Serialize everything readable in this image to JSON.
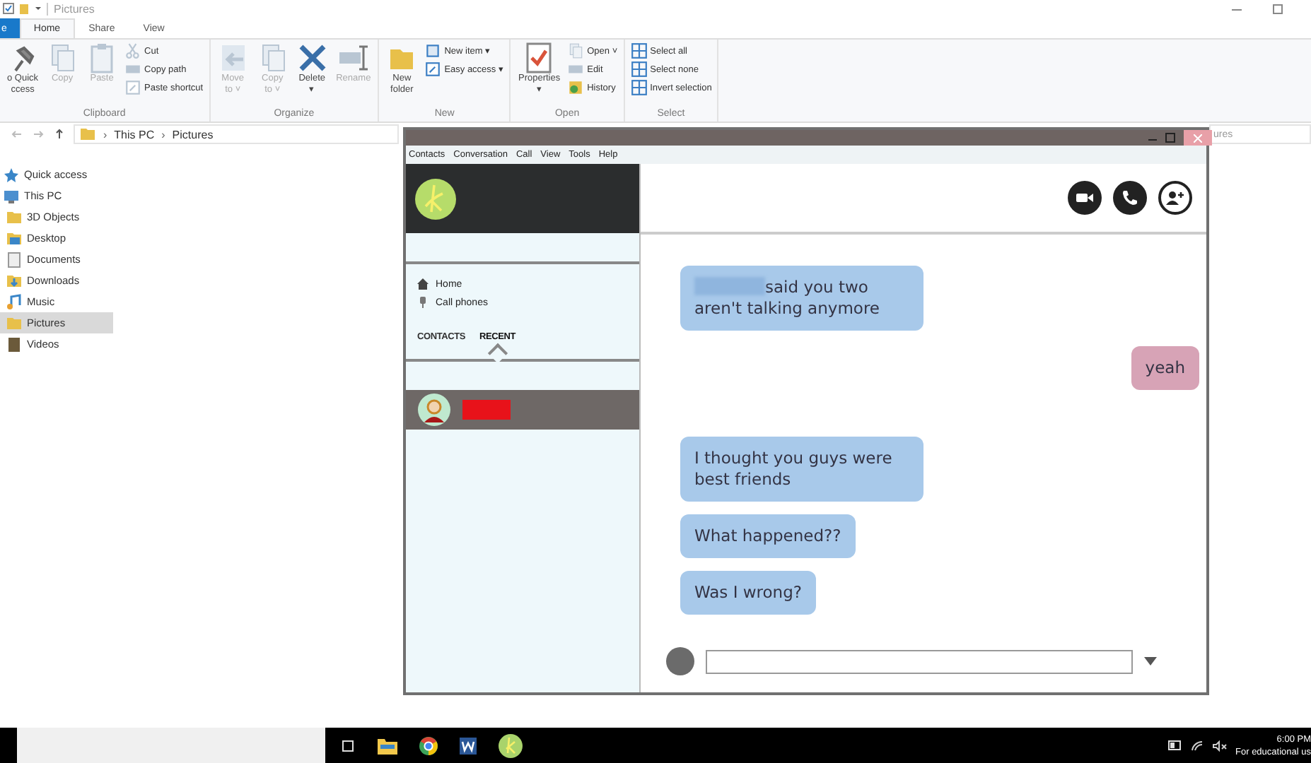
{
  "explorer": {
    "title": "Pictures",
    "ribbon_tabs": [
      {
        "label": "e",
        "kind": "file",
        "selected": false
      },
      {
        "label": "Home",
        "kind": "tab",
        "selected": true
      },
      {
        "label": "Share",
        "kind": "tab",
        "selected": false
      },
      {
        "label": "View",
        "kind": "tab",
        "selected": false
      }
    ],
    "ribbon_groups": [
      {
        "name": "Clipboard",
        "large": [
          {
            "lines": [
              "o Quick",
              "ccess"
            ],
            "kind": "pin",
            "disabled": false
          },
          {
            "lines": [
              "Copy"
            ],
            "kind": "pages",
            "disabled": true
          },
          {
            "lines": [
              "Paste"
            ],
            "kind": "clipboard",
            "disabled": true
          }
        ],
        "small": [
          {
            "label": "Cut",
            "kind": "scissors",
            "disabled": true
          },
          {
            "label": "Copy path",
            "kind": "path",
            "disabled": true
          },
          {
            "label": "Paste shortcut",
            "kind": "shortcut",
            "disabled": true
          }
        ]
      },
      {
        "name": "Organize",
        "large": [
          {
            "lines": [
              "Move",
              "to ˅"
            ],
            "kind": "move",
            "disabled": true
          },
          {
            "lines": [
              "Copy",
              "to ˅"
            ],
            "kind": "pages",
            "disabled": true
          },
          {
            "lines": [
              "Delete",
              "▾"
            ],
            "kind": "cross",
            "disabled": false
          },
          {
            "lines": [
              "Rename"
            ],
            "kind": "rename",
            "disabled": true
          }
        ]
      },
      {
        "name": "New",
        "large": [
          {
            "lines": [
              "New",
              "folder"
            ],
            "kind": "folder",
            "disabled": false
          }
        ],
        "small": [
          {
            "label": "New item ▾",
            "kind": "newitem",
            "disabled": false
          },
          {
            "label": "Easy access ▾",
            "kind": "shortcut",
            "disabled": false
          }
        ]
      },
      {
        "name": "Open",
        "large": [
          {
            "lines": [
              "Properties",
              "▾"
            ],
            "kind": "check",
            "disabled": false
          }
        ],
        "small": [
          {
            "label": "Open ˅",
            "kind": "pages",
            "disabled": true
          },
          {
            "label": "Edit",
            "kind": "path",
            "disabled": true
          },
          {
            "label": "History",
            "kind": "history",
            "disabled": false
          }
        ]
      },
      {
        "name": "Select",
        "small": [
          {
            "label": "Select all",
            "kind": "grid",
            "disabled": false
          },
          {
            "label": "Select none",
            "kind": "grid",
            "disabled": false
          },
          {
            "label": "Invert selection",
            "kind": "grid",
            "disabled": false
          }
        ]
      }
    ],
    "breadcrumb": [
      {
        "separator": "›",
        "label": "This PC"
      },
      {
        "separator": "›",
        "label": "Pictures"
      }
    ],
    "search_text": "ures",
    "nav_items": [
      {
        "label": "Quick access",
        "kind": "star",
        "selected": false
      },
      {
        "label": "This PC",
        "kind": "pc",
        "selected": false
      },
      {
        "label": "3D Objects",
        "kind": "folder",
        "selected": false
      },
      {
        "label": "Desktop",
        "kind": "desktop",
        "selected": false
      },
      {
        "label": "Documents",
        "kind": "doc",
        "selected": false
      },
      {
        "label": "Downloads",
        "kind": "download",
        "selected": false
      },
      {
        "label": "Music",
        "kind": "music",
        "selected": false
      },
      {
        "label": "Pictures",
        "kind": "folder",
        "selected": true
      },
      {
        "label": "Videos",
        "kind": "video",
        "selected": false
      }
    ]
  },
  "chat": {
    "menu": [
      "Contacts",
      "Conversation",
      "Call",
      "View",
      "Tools",
      "Help"
    ],
    "nav": [
      {
        "label": "Home",
        "kind": "home"
      },
      {
        "label": "Call phones",
        "kind": "phone"
      }
    ],
    "tabs": [
      {
        "label": "CONTACTS",
        "selected": false
      },
      {
        "label": "RECENT",
        "selected": true
      }
    ],
    "recent": [
      {
        "name_redacted": true,
        "selected": true
      }
    ],
    "messages": [
      {
        "kind": "incoming",
        "redacted_prefix": true,
        "text": "said you two aren't talking anymore"
      },
      {
        "kind": "outgoing",
        "redacted_prefix": false,
        "text": "yeah"
      },
      {
        "kind": "incoming",
        "redacted_prefix": false,
        "text": "I thought you guys were best friends"
      },
      {
        "kind": "incoming",
        "redacted_prefix": false,
        "text": "What happened??"
      },
      {
        "kind": "incoming",
        "redacted_prefix": false,
        "text": "Was I wrong?"
      }
    ]
  },
  "taskbar": {
    "apps": [
      {
        "kind": "taskview"
      },
      {
        "kind": "explorer"
      },
      {
        "kind": "chrome"
      },
      {
        "kind": "word"
      },
      {
        "kind": "chat"
      }
    ],
    "time": "6:00 PM",
    "note": "For educational us"
  }
}
